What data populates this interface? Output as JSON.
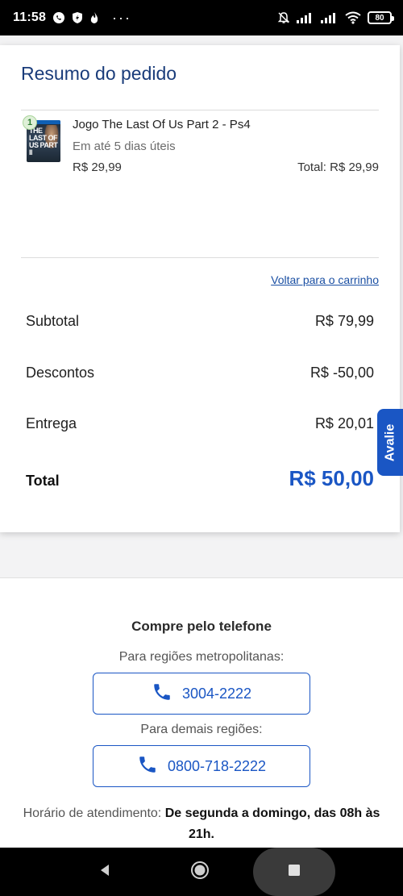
{
  "status_bar": {
    "time": "11:58",
    "dots": "···",
    "battery": "80"
  },
  "order_summary": {
    "title": "Resumo do pedido",
    "item": {
      "quantity": "1",
      "name": "Jogo The Last Of Us Part 2 - Ps4",
      "delivery": "Em até 5 dias úteis",
      "price": "R$ 29,99",
      "total": "Total: R$ 29,99",
      "cover_text": "THE LAST OF US PART II"
    },
    "back_link": "Voltar para o carrinho",
    "subtotal_label": "Subtotal",
    "subtotal_value": "R$ 79,99",
    "discounts_label": "Descontos",
    "discounts_value": "R$ -50,00",
    "delivery_label": "Entrega",
    "delivery_value": "R$ 20,01",
    "total_label": "Total",
    "total_value": "R$ 50,00"
  },
  "feedback_tab": {
    "label": "Avalie"
  },
  "phone_purchase": {
    "title": "Compre pelo telefone",
    "metro_label": "Para regiões metropolitanas:",
    "metro_number": "3004-2222",
    "other_label": "Para demais regiões:",
    "other_number": "0800-718-2222",
    "hours_label": "Horário de atendimento:",
    "hours_value": "De segunda a domingo, das 08h às 21h."
  },
  "colors": {
    "brand_blue": "#1a56c4",
    "title_navy": "#1a3c7a",
    "link_blue": "#1a4fa3"
  },
  "icons": [
    "whatsapp-icon",
    "shield-icon",
    "flame-icon",
    "bell-off-icon",
    "signal-icon",
    "wifi-icon",
    "battery-icon",
    "phone-icon",
    "back-icon",
    "home-icon",
    "recents-icon"
  ]
}
